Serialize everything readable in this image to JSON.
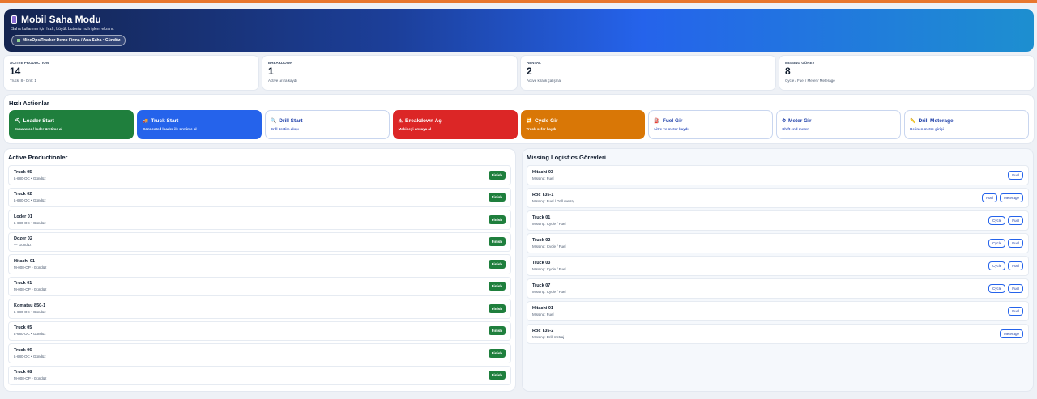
{
  "hero": {
    "title": "Mobil Saha Modu",
    "subtitle": "Saha kullanımı için hızlı, büyük butonlu hızlı işlem ekranı.",
    "context": "MineOps/Tracker Demo Firma / Ana Saha • Gündüz",
    "accent_colors": [
      "#14244f",
      "#2563eb",
      "#1d8fd0"
    ]
  },
  "stats": [
    {
      "label": "ACTIVE PRODUCTION",
      "value": "14",
      "sub": "Truck: 8 - Drill: 1"
    },
    {
      "label": "BREAKDOWN",
      "value": "1",
      "sub": "Active arıza kaydı"
    },
    {
      "label": "RENTAL",
      "value": "2",
      "sub": "Active kiralık çalışma"
    },
    {
      "label": "MISSING GÖREV",
      "value": "8",
      "sub": "Cycle / Fuel / Meter / Meterage"
    }
  ],
  "quick_actions": {
    "title": "Hızlı Actionlar",
    "items": [
      {
        "icon": "shovel-icon",
        "glyph": "⛏",
        "title": "Loader Start",
        "sub": "Excavator / loder üretime al",
        "color": "#1f7f3d"
      },
      {
        "icon": "truck-icon",
        "glyph": "🚚",
        "title": "Truck Start",
        "sub": "Connected loader ile üretime al",
        "color": "#2563eb"
      },
      {
        "icon": "drill-icon",
        "glyph": "🔍",
        "title": "Drill Start",
        "sub": "Drill üretim akışı",
        "color": "#ffffff"
      },
      {
        "icon": "warning-icon",
        "glyph": "⚠",
        "title": "Breakdown Aç",
        "sub": "Makineyi arızaya al",
        "color": "#dc2626"
      },
      {
        "icon": "cycle-icon",
        "glyph": "🔁",
        "title": "Cycle Gir",
        "sub": "Truck sefer kaydı",
        "color": "#d97706"
      },
      {
        "icon": "fuel-icon",
        "glyph": "⛽",
        "title": "Fuel Gir",
        "sub": "Litre ve meter kaydı",
        "color": "#ffffff"
      },
      {
        "icon": "meter-icon",
        "glyph": "⏱",
        "title": "Meter Gir",
        "sub": "Shift end meter",
        "color": "#ffffff"
      },
      {
        "icon": "ruler-icon",
        "glyph": "📏",
        "title": "Drill Meterage",
        "sub": "Delinen metre girişi",
        "color": "#ffffff"
      }
    ]
  },
  "active_productions": {
    "title": "Active Productionler",
    "finish_label": "Finish",
    "rows": [
      {
        "name": "Truck 05",
        "sub": "L-680-OC • Gündüz"
      },
      {
        "name": "Truck 02",
        "sub": "L-680-OC • Gündüz"
      },
      {
        "name": "Loder 01",
        "sub": "L-680-OC • Gündüz"
      },
      {
        "name": "Dozer 02",
        "sub": "— Gündüz"
      },
      {
        "name": "Hitachi 01",
        "sub": "M-008-OP • Gündüz"
      },
      {
        "name": "Truck 01",
        "sub": "M-008-OP • Gündüz"
      },
      {
        "name": "Komatsu 850-1",
        "sub": "L-680-OC • Gündüz"
      },
      {
        "name": "Truck 05",
        "sub": "L-680-OC • Gündüz"
      },
      {
        "name": "Truck 06",
        "sub": "L-680-OC • Gündüz"
      },
      {
        "name": "Truck 08",
        "sub": "M-008-OP • Gündüz"
      }
    ]
  },
  "missing_logistics": {
    "title": "Missing Logistics Görevleri",
    "rows": [
      {
        "name": "Hitachi 03",
        "sub": "Missing: Fuel",
        "tags": [
          "Fuel"
        ]
      },
      {
        "name": "Roc T35-1",
        "sub": "Missing: Fuel / Drill metraj",
        "tags": [
          "Fuel",
          "Meterage"
        ]
      },
      {
        "name": "Truck 01",
        "sub": "Missing: Cycle / Fuel",
        "tags": [
          "Cycle",
          "Fuel"
        ]
      },
      {
        "name": "Truck 02",
        "sub": "Missing: Cycle / Fuel",
        "tags": [
          "Cycle",
          "Fuel"
        ]
      },
      {
        "name": "Truck 03",
        "sub": "Missing: Cycle / Fuel",
        "tags": [
          "Cycle",
          "Fuel"
        ]
      },
      {
        "name": "Truck 07",
        "sub": "Missing: Cycle / Fuel",
        "tags": [
          "Cycle",
          "Fuel"
        ]
      },
      {
        "name": "Hitachi 01",
        "sub": "Missing: Fuel",
        "tags": [
          "Fuel"
        ]
      },
      {
        "name": "Roc T35-2",
        "sub": "Missing: Drill metraj",
        "tags": [
          "Meterage"
        ]
      }
    ]
  }
}
